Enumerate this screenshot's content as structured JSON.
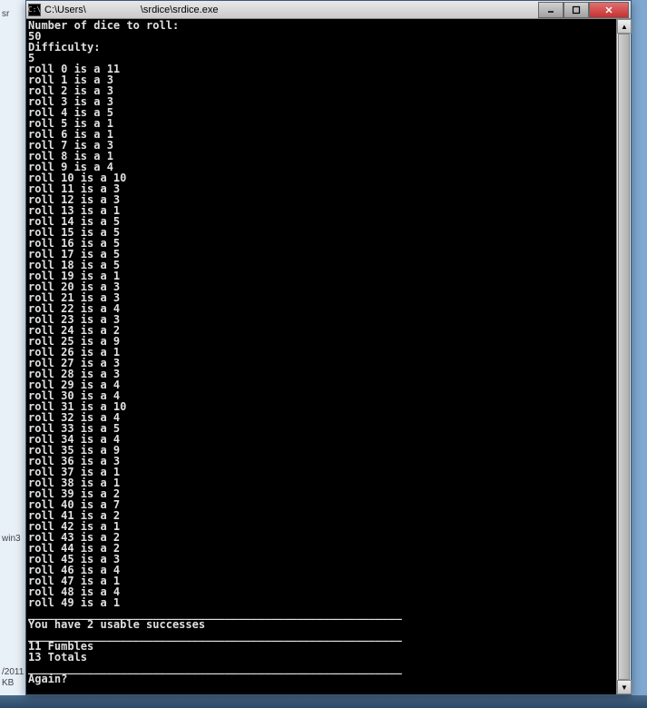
{
  "background": {
    "partial_tab": "sr",
    "partial_label": "win3",
    "date_fragment": "/2011",
    "size_fragment": "KB"
  },
  "window": {
    "icon_text": "C:\\",
    "title_part1": "C:\\Users\\",
    "title_part2": "\\srdice\\srdice.exe",
    "buttons": {
      "minimize": "–",
      "maximize": "❐",
      "close": "✕"
    }
  },
  "console": {
    "prompt_dice": "Number of dice to roll:",
    "input_dice": "50",
    "prompt_diff": "Difficulty:",
    "input_diff": "5",
    "rolls": [
      {
        "i": 0,
        "v": 11
      },
      {
        "i": 1,
        "v": 3
      },
      {
        "i": 2,
        "v": 3
      },
      {
        "i": 3,
        "v": 3
      },
      {
        "i": 4,
        "v": 5
      },
      {
        "i": 5,
        "v": 1
      },
      {
        "i": 6,
        "v": 1
      },
      {
        "i": 7,
        "v": 3
      },
      {
        "i": 8,
        "v": 1
      },
      {
        "i": 9,
        "v": 4
      },
      {
        "i": 10,
        "v": 10
      },
      {
        "i": 11,
        "v": 3
      },
      {
        "i": 12,
        "v": 3
      },
      {
        "i": 13,
        "v": 1
      },
      {
        "i": 14,
        "v": 5
      },
      {
        "i": 15,
        "v": 5
      },
      {
        "i": 16,
        "v": 5
      },
      {
        "i": 17,
        "v": 5
      },
      {
        "i": 18,
        "v": 5
      },
      {
        "i": 19,
        "v": 1
      },
      {
        "i": 20,
        "v": 3
      },
      {
        "i": 21,
        "v": 3
      },
      {
        "i": 22,
        "v": 4
      },
      {
        "i": 23,
        "v": 3
      },
      {
        "i": 24,
        "v": 2
      },
      {
        "i": 25,
        "v": 9
      },
      {
        "i": 26,
        "v": 1
      },
      {
        "i": 27,
        "v": 3
      },
      {
        "i": 28,
        "v": 3
      },
      {
        "i": 29,
        "v": 4
      },
      {
        "i": 30,
        "v": 4
      },
      {
        "i": 31,
        "v": 10
      },
      {
        "i": 32,
        "v": 4
      },
      {
        "i": 33,
        "v": 5
      },
      {
        "i": 34,
        "v": 4
      },
      {
        "i": 35,
        "v": 9
      },
      {
        "i": 36,
        "v": 3
      },
      {
        "i": 37,
        "v": 1
      },
      {
        "i": 38,
        "v": 1
      },
      {
        "i": 39,
        "v": 2
      },
      {
        "i": 40,
        "v": 7
      },
      {
        "i": 41,
        "v": 2
      },
      {
        "i": 42,
        "v": 1
      },
      {
        "i": 43,
        "v": 2
      },
      {
        "i": 44,
        "v": 2
      },
      {
        "i": 45,
        "v": 3
      },
      {
        "i": 46,
        "v": 4
      },
      {
        "i": 47,
        "v": 1
      },
      {
        "i": 48,
        "v": 4
      },
      {
        "i": 49,
        "v": 1
      }
    ],
    "separator": "_________________________________________________________",
    "success_line": "You have 2 usable successes",
    "fumbles_line": "11 Fumbles",
    "totals_line": "13 Totals",
    "again_prompt": "Again?",
    "cursor": "_"
  }
}
